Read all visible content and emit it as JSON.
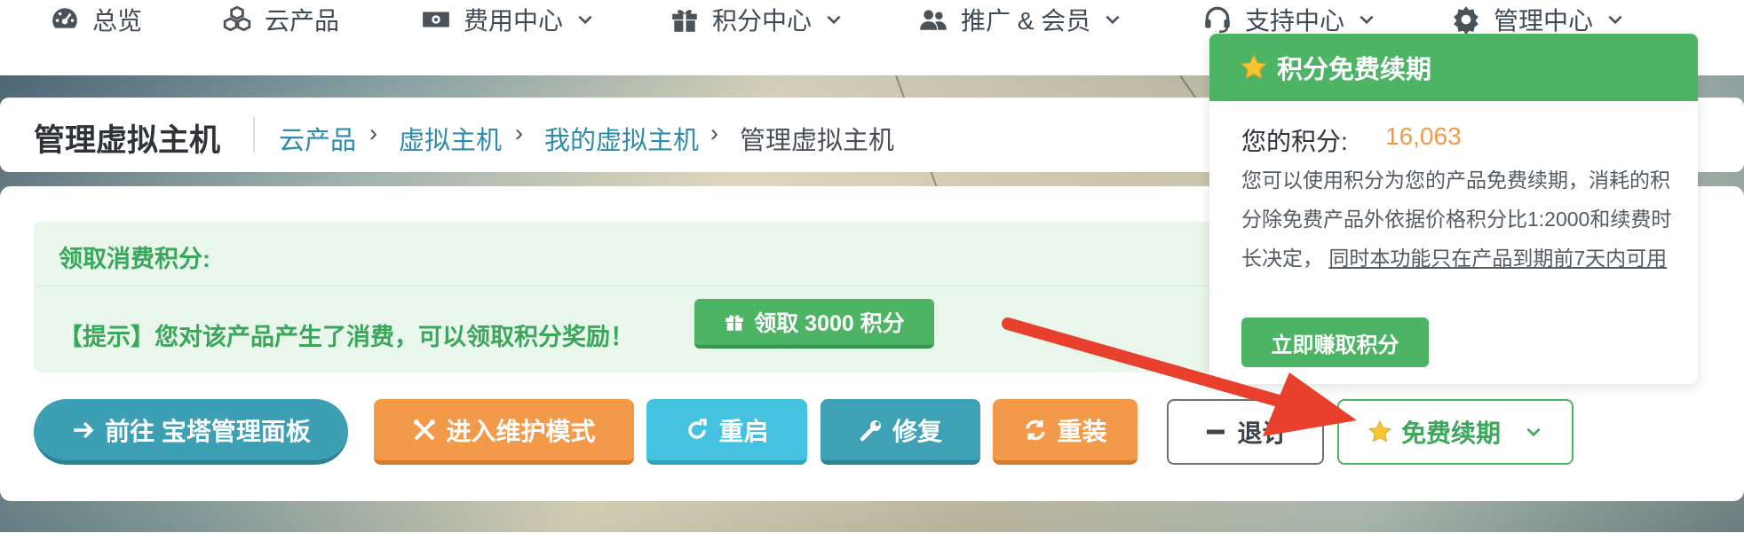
{
  "nav": {
    "items": [
      {
        "label": "总览",
        "icon": "dashboard-icon",
        "dropdown": false
      },
      {
        "label": "云产品",
        "icon": "cubes-icon",
        "dropdown": false
      },
      {
        "label": "费用中心",
        "icon": "money-icon",
        "dropdown": true
      },
      {
        "label": "积分中心",
        "icon": "gift-icon",
        "dropdown": true
      },
      {
        "label": "推广 & 会员",
        "icon": "users-icon",
        "dropdown": true
      },
      {
        "label": "支持中心",
        "icon": "headset-icon",
        "dropdown": true
      },
      {
        "label": "管理中心",
        "icon": "gear-icon",
        "dropdown": true
      }
    ]
  },
  "breadcrumb": {
    "title": "管理虚拟主机",
    "items": [
      "云产品",
      "虚拟主机",
      "我的虚拟主机",
      "管理虚拟主机"
    ],
    "separator": "›"
  },
  "points_box": {
    "title": "领取消费积分:",
    "hint": "【提示】您对该产品产生了消费，可以领取积分奖励！",
    "claim_button": "领取 3000 积分"
  },
  "actions": {
    "bt_panel": "前往 宝塔管理面板",
    "maintenance": "进入维护模式",
    "reboot": "重启",
    "repair": "修复",
    "reinstall": "重装",
    "cancel": "退订",
    "free_renew": "免费续期"
  },
  "popover": {
    "title": "积分免费续期",
    "points_label": "您的积分:",
    "points_value": "16,063",
    "desc_part1": "您可以使用积分为您的产品免费续期，消耗的积分除免费产品外依据价格积分比1:2000和续费时长决定，",
    "desc_part2": "同时本功能只在产品到期前7天内可用",
    "earn_button": "立即赚取积分"
  },
  "colors": {
    "green": "#4cb464",
    "orange": "#f39a4a",
    "teal": "#3d9fb3",
    "cyan": "#45c2df",
    "link": "#2e8aa8",
    "arrow": "#e8402c"
  }
}
